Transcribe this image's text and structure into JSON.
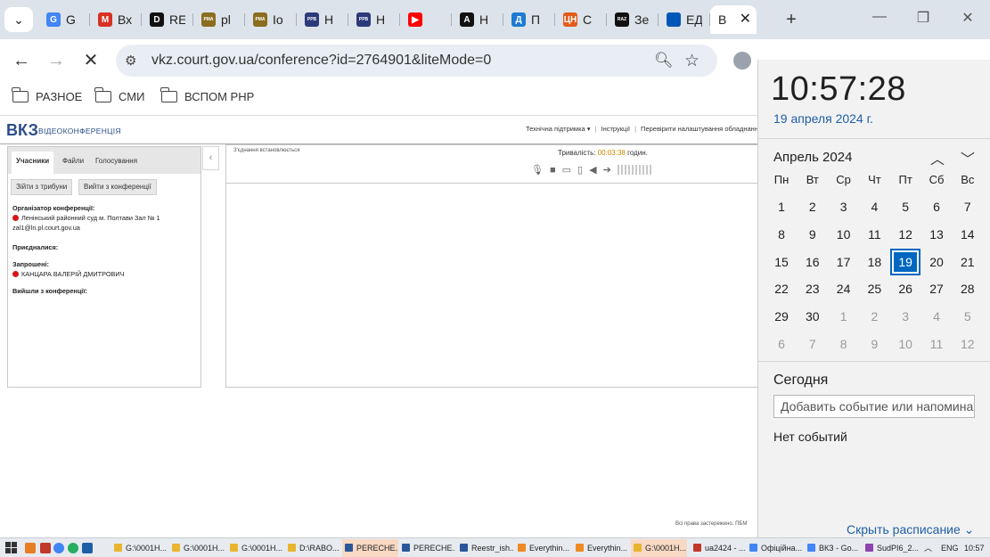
{
  "browser": {
    "tabs": [
      {
        "title": "G",
        "icon": "google-icon",
        "color": "#4285f4",
        "glyph": "G"
      },
      {
        "title": "Вх",
        "icon": "gmail-icon",
        "color": "#d93025",
        "glyph": "M"
      },
      {
        "title": "RE",
        "icon": "d-site-icon",
        "color": "#111111",
        "glyph": "D"
      },
      {
        "title": "рl",
        "icon": "rma-icon",
        "color": "#8a6d1f",
        "glyph": "РМА"
      },
      {
        "title": "Іо",
        "icon": "rma-icon",
        "color": "#8a6d1f",
        "glyph": "РМА"
      },
      {
        "title": "Н",
        "icon": "ppb-icon",
        "color": "#2d3a7a",
        "glyph": "PPB"
      },
      {
        "title": "Н",
        "icon": "ppb-icon",
        "color": "#2d3a7a",
        "glyph": "PPB"
      },
      {
        "title": "",
        "icon": "youtube-icon",
        "color": "#ff0000",
        "glyph": "▶"
      },
      {
        "title": "Н",
        "icon": "a-site-icon",
        "color": "#111111",
        "glyph": "A"
      },
      {
        "title": "П",
        "icon": "d-blue-icon",
        "color": "#1e7bd1",
        "glyph": "Д"
      },
      {
        "title": "С",
        "icon": "cn-icon",
        "color": "#e35b1a",
        "glyph": "ЦН"
      },
      {
        "title": "Зе",
        "icon": "raz-icon",
        "color": "#111111",
        "glyph": "RAZ"
      },
      {
        "title": "ЕД",
        "icon": "ua-flag-icon",
        "color": "#0057b7",
        "glyph": ""
      },
      {
        "title": "В",
        "icon": "",
        "color": "",
        "glyph": "",
        "active": true
      }
    ],
    "close_glyph": "✕",
    "new_tab_glyph": "+",
    "tabs_menu_glyph": "⌄",
    "url": "vkz.court.gov.ua/conference?id=2764901&liteMode=0",
    "bookmarks": [
      "РАЗНОЕ",
      "СМИ",
      "ВСПОМ РНР"
    ]
  },
  "page": {
    "logo": "ВКЗ",
    "logo_sub": "ВІДЕОКОНФЕРЕНЦІЯ",
    "links": [
      "Технічна підтримка ▾",
      "Інструкції",
      "Перевірити налаштування обладнання"
    ],
    "tabs": [
      "Учасники",
      "Файли",
      "Голосування"
    ],
    "buttons": [
      "Зійти з трибуни",
      "Вийти з конференції"
    ],
    "organizer_label": "Організатор конференції:",
    "organizer_name": "Ленінський районний суд м. Полтави Зал № 1",
    "organizer_email": "zal1@ln.pl.court.gov.ua",
    "joined_label": "Приєдналися:",
    "invited_label": "Запрошені:",
    "invited_name": "КАНЦАРА ВАЛЕРІЙ ДМИТРОВИЧ",
    "left_label": "Вийшли з конференції:",
    "status": "З'єднання встановлюється",
    "duration_label": "Тривалість:",
    "duration": "00:03:38",
    "duration_unit": "годин.",
    "footer": "Всі права застережено. ПБМ"
  },
  "calendar": {
    "time": "10:57:28",
    "date": "19 апреля 2024 г.",
    "month": "Апрель 2024",
    "weekdays": [
      "Пн",
      "Вт",
      "Ср",
      "Чт",
      "Пт",
      "Сб",
      "Вс"
    ],
    "weeks": [
      [
        "1",
        "2",
        "3",
        "4",
        "5",
        "6",
        "7"
      ],
      [
        "8",
        "9",
        "10",
        "11",
        "12",
        "13",
        "14"
      ],
      [
        "15",
        "16",
        "17",
        "18",
        "19",
        "20",
        "21"
      ],
      [
        "22",
        "23",
        "24",
        "25",
        "26",
        "27",
        "28"
      ],
      [
        "29",
        "30",
        "1",
        "2",
        "3",
        "4",
        "5"
      ],
      [
        "6",
        "7",
        "8",
        "9",
        "10",
        "11",
        "12"
      ]
    ],
    "selected_day": "19",
    "today_label": "Сегодня",
    "event_placeholder": "Добавить событие или напоминание",
    "no_events": "Нет событий",
    "hide_schedule": "Скрыть расписание ⌄"
  },
  "taskbar": {
    "apps": [
      {
        "label": "G:\\0001H...",
        "color": "#e8b530"
      },
      {
        "label": "G:\\0001H...",
        "color": "#e8b530"
      },
      {
        "label": "G:\\0001H...",
        "color": "#e8b530"
      },
      {
        "label": "D:\\RABO...",
        "color": "#e8b530"
      },
      {
        "label": "PERECHE...",
        "color": "#2b579a",
        "active": true
      },
      {
        "label": "PERECHE...",
        "color": "#2b579a"
      },
      {
        "label": "Reestr_ish...",
        "color": "#2b579a"
      },
      {
        "label": "Everythin...",
        "color": "#f08a24"
      },
      {
        "label": "Everythin...",
        "color": "#f08a24"
      },
      {
        "label": "G:\\0001H...",
        "color": "#e8b530",
        "active": true
      },
      {
        "label": "ua2424 - ...",
        "color": "#c0392b"
      },
      {
        "label": "Офіційна...",
        "color": "#4285f4"
      },
      {
        "label": "ВКЗ - Go...",
        "color": "#4285f4"
      },
      {
        "label": "SudPI6_2...",
        "color": "#8e44ad"
      }
    ],
    "lang": "ENG",
    "time": "10:57"
  },
  "colors": {
    "accent": "#0067c0",
    "link": "#1f5fa8",
    "live_dot": "#d51717"
  }
}
